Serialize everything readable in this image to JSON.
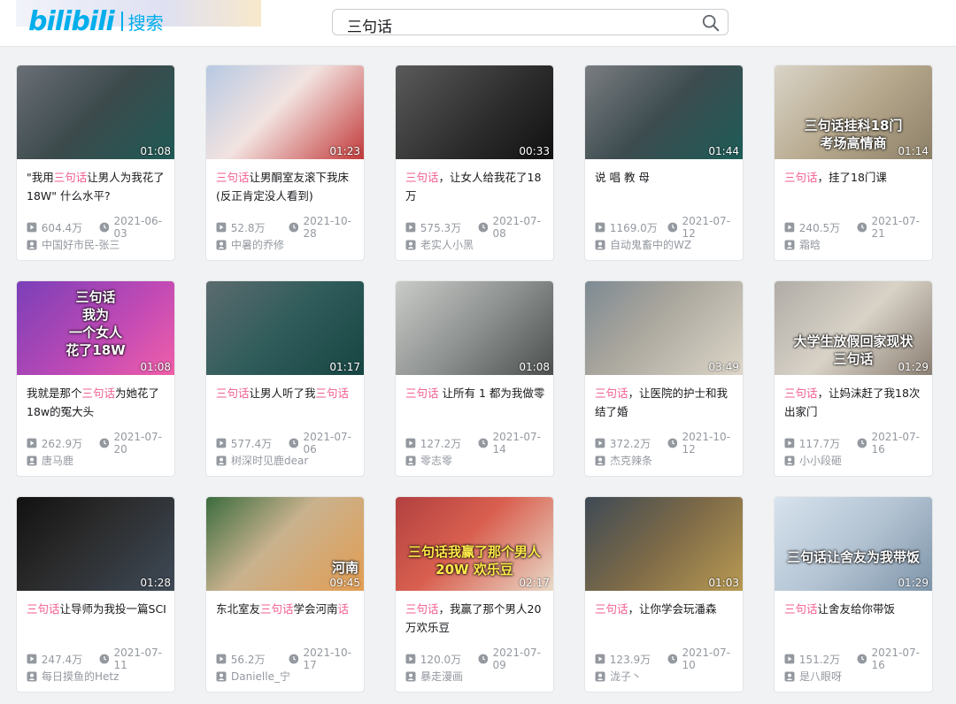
{
  "header": {
    "logo": "bilibili",
    "logo_sub": "搜索",
    "search_value": "三句话"
  },
  "colors": {
    "accent": "#00aeec",
    "highlight": "#f25d8e",
    "meta": "#9499a0"
  },
  "videos": [
    {
      "title_parts": [
        {
          "t": "\"我用",
          "h": false
        },
        {
          "t": "三句话",
          "h": true
        },
        {
          "t": "让男人为我花了18W\" 什么水平?",
          "h": false
        }
      ],
      "duration": "01:08",
      "plays": "604.4万",
      "date": "2021-06-03",
      "author": "中国好市民-张三"
    },
    {
      "title_parts": [
        {
          "t": "三句话",
          "h": true
        },
        {
          "t": "让男酮室友滚下我床(反正肯定没人看到)",
          "h": false
        }
      ],
      "duration": "01:23",
      "plays": "52.8万",
      "date": "2021-10-28",
      "author": "中暑的乔修"
    },
    {
      "title_parts": [
        {
          "t": "三句话",
          "h": true
        },
        {
          "t": "，让女人给我花了18万",
          "h": false
        }
      ],
      "duration": "00:33",
      "plays": "575.3万",
      "date": "2021-07-08",
      "author": "老实人小黑"
    },
    {
      "title_parts": [
        {
          "t": "说 唱 教 母",
          "h": false
        }
      ],
      "duration": "01:44",
      "plays": "1169.0万",
      "date": "2021-07-12",
      "author": "自动鬼畜中的WZ"
    },
    {
      "title_parts": [
        {
          "t": "三句话",
          "h": true
        },
        {
          "t": "，挂了18门课",
          "h": false
        }
      ],
      "duration": "01:14",
      "plays": "240.5万",
      "date": "2021-07-21",
      "author": "霜晗",
      "overlay": "三句话挂科18门\n考场高情商"
    },
    {
      "title_parts": [
        {
          "t": "我就是那个",
          "h": false
        },
        {
          "t": "三句话",
          "h": true
        },
        {
          "t": "为她花了18w的冤大头",
          "h": false
        }
      ],
      "duration": "01:08",
      "plays": "262.9万",
      "date": "2021-07-20",
      "author": "唐马鹿",
      "overlay": "三句话\n我为\n一个女人\n花了18W"
    },
    {
      "title_parts": [
        {
          "t": "三句话",
          "h": true
        },
        {
          "t": "让男人听了我",
          "h": false
        },
        {
          "t": "三句话",
          "h": true
        }
      ],
      "duration": "01:17",
      "plays": "577.4万",
      "date": "2021-07-06",
      "author": "树深时见鹿dear"
    },
    {
      "title_parts": [
        {
          "t": "三句话",
          "h": true
        },
        {
          "t": " 让所有 1 都为我做零",
          "h": false
        }
      ],
      "duration": "01:08",
      "plays": "127.2万",
      "date": "2021-07-14",
      "author": "零志零"
    },
    {
      "title_parts": [
        {
          "t": "三句话",
          "h": true
        },
        {
          "t": "，让医院的护士和我结了婚",
          "h": false
        }
      ],
      "duration": "03:49",
      "plays": "372.2万",
      "date": "2021-10-12",
      "author": "杰克辣条"
    },
    {
      "title_parts": [
        {
          "t": "三句话",
          "h": true
        },
        {
          "t": "，让妈沫赶了我18次出家门",
          "h": false
        }
      ],
      "duration": "01:29",
      "plays": "117.7万",
      "date": "2021-07-16",
      "author": "小小段砸",
      "overlay": "大学生放假回家现状\n三句话"
    },
    {
      "title_parts": [
        {
          "t": "三句话",
          "h": true
        },
        {
          "t": "让导师为我投一篇SCI",
          "h": false
        }
      ],
      "duration": "01:28",
      "plays": "247.4万",
      "date": "2021-07-11",
      "author": "每日摸鱼的Hetz"
    },
    {
      "title_parts": [
        {
          "t": "东北室友",
          "h": false
        },
        {
          "t": "三句话",
          "h": true
        },
        {
          "t": "学会河南",
          "h": false
        },
        {
          "t": "话",
          "h": true
        }
      ],
      "duration": "09:45",
      "plays": "56.2万",
      "date": "2021-10-17",
      "author": "Danielle_宁",
      "overlay": "河南"
    },
    {
      "title_parts": [
        {
          "t": "三句话",
          "h": true
        },
        {
          "t": "，我赢了那个男人20万欢乐豆",
          "h": false
        }
      ],
      "duration": "02:17",
      "plays": "120.0万",
      "date": "2021-07-09",
      "author": "暴走漫画",
      "overlay": "三句话我赢了那个男人\n20W 欢乐豆"
    },
    {
      "title_parts": [
        {
          "t": "三句话",
          "h": true
        },
        {
          "t": "，让你学会玩潘森",
          "h": false
        }
      ],
      "duration": "01:03",
      "plays": "123.9万",
      "date": "2021-07-10",
      "author": "泷子丶"
    },
    {
      "title_parts": [
        {
          "t": "三句话",
          "h": true
        },
        {
          "t": "让舍友给你带饭",
          "h": false
        }
      ],
      "duration": "01:29",
      "plays": "151.2万",
      "date": "2021-07-16",
      "author": "是八眼呀",
      "overlay": "三句话让舍友为我带饭"
    }
  ]
}
